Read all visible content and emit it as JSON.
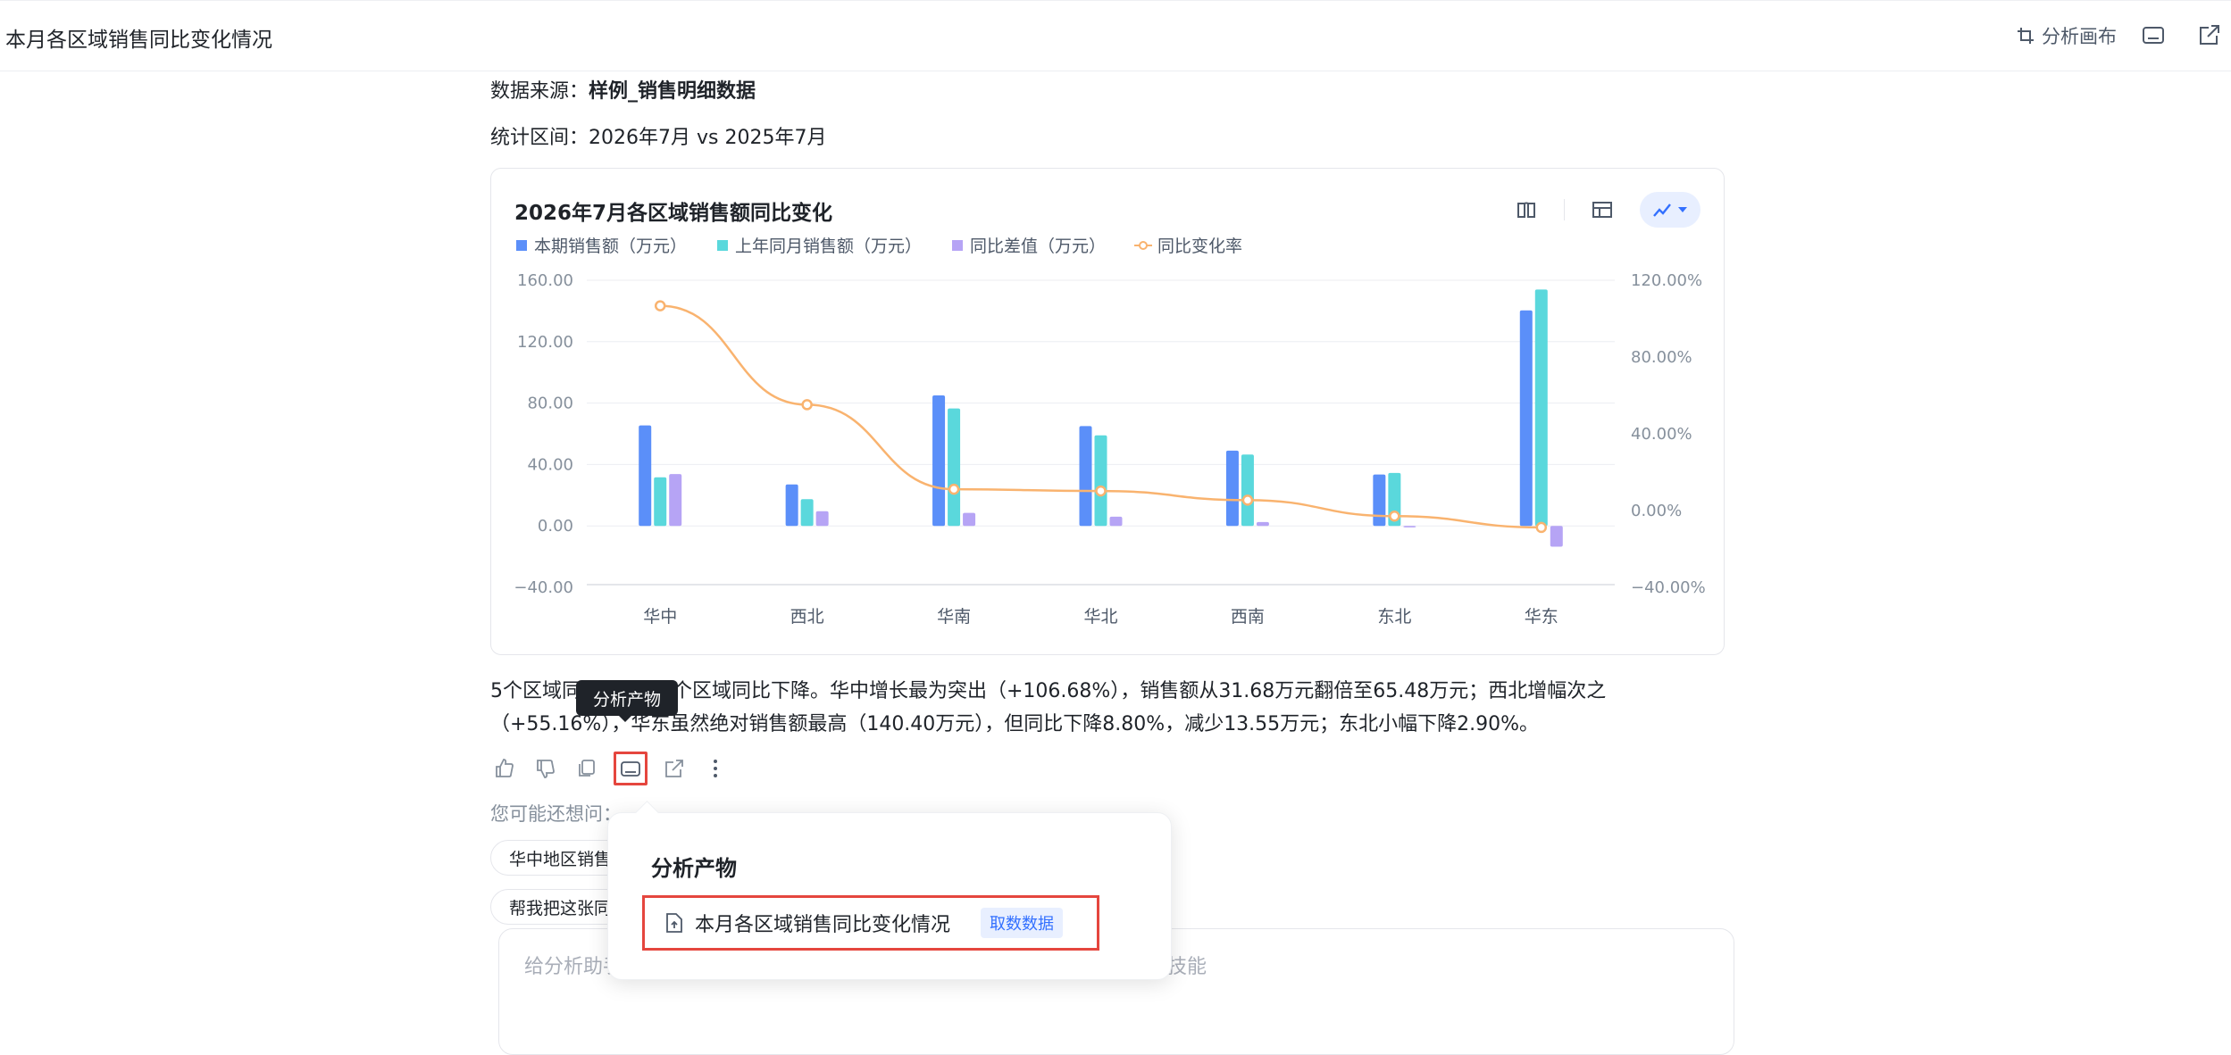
{
  "header": {
    "title": "本月各区域销售同比变化情况",
    "canvas_button": "分析画布"
  },
  "meta": {
    "source_label": "数据来源：",
    "source_value": "样例_销售明细数据",
    "period_label": "统计区间：",
    "period_value": "2026年7月 vs 2025年7月"
  },
  "chart_data": {
    "type": "bar",
    "title": "2026年7月各区域销售额同比变化",
    "categories": [
      "华中",
      "西北",
      "华南",
      "华北",
      "西南",
      "东北",
      "华东"
    ],
    "series": [
      {
        "name": "本期销售额（万元）",
        "type": "bar",
        "axis": "left",
        "color": "#5b8ff9",
        "values": [
          65.48,
          27.0,
          85.0,
          65.0,
          49.0,
          33.5,
          140.4
        ]
      },
      {
        "name": "上年同月销售额（万元）",
        "type": "bar",
        "axis": "left",
        "color": "#5ad8dc",
        "values": [
          31.68,
          17.4,
          76.5,
          59.0,
          46.5,
          34.5,
          153.95
        ]
      },
      {
        "name": "同比差值（万元）",
        "type": "bar",
        "axis": "left",
        "color": "#b6a4f5",
        "values": [
          33.8,
          9.6,
          8.5,
          6.0,
          2.5,
          -1.0,
          -13.55
        ]
      },
      {
        "name": "同比变化率",
        "type": "line",
        "axis": "right",
        "color": "#f9b36f",
        "values": [
          106.68,
          55.16,
          11.1,
          10.2,
          5.4,
          -2.9,
          -8.8
        ]
      }
    ],
    "y_left": {
      "min": -40,
      "max": 160,
      "ticks": [
        "160.00",
        "120.00",
        "80.00",
        "40.00",
        "0.00",
        "−40.00"
      ]
    },
    "y_right": {
      "min": -40,
      "max": 120,
      "ticks": [
        "120.00%",
        "80.00%",
        "40.00%",
        "0.00%",
        "−40.00%"
      ]
    },
    "legend_position": "top-left",
    "grid": true
  },
  "summary": {
    "line1": "5个区域同比增长，2个区域同比下降。华中增长最为突出（+106.68%），销售额从31.68万元翻倍至65.48万元；西北增幅次之",
    "line2": "（+55.16%），华东虽然绝对销售额最高（140.40万元），但同比下降8.80%，减少13.55万元；东北小幅下降2.90%。"
  },
  "tooltip": "分析产物",
  "suggest": {
    "label": "您可能还想问：",
    "chip1": "华中地区销售",
    "chip2": "帮我把这张同"
  },
  "input": {
    "placeholder_left": "给分析助手",
    "placeholder_right": "技能"
  },
  "popup": {
    "title": "分析产物",
    "item_name": "本月各区域销售同比变化情况",
    "item_tag": "取数数据"
  }
}
